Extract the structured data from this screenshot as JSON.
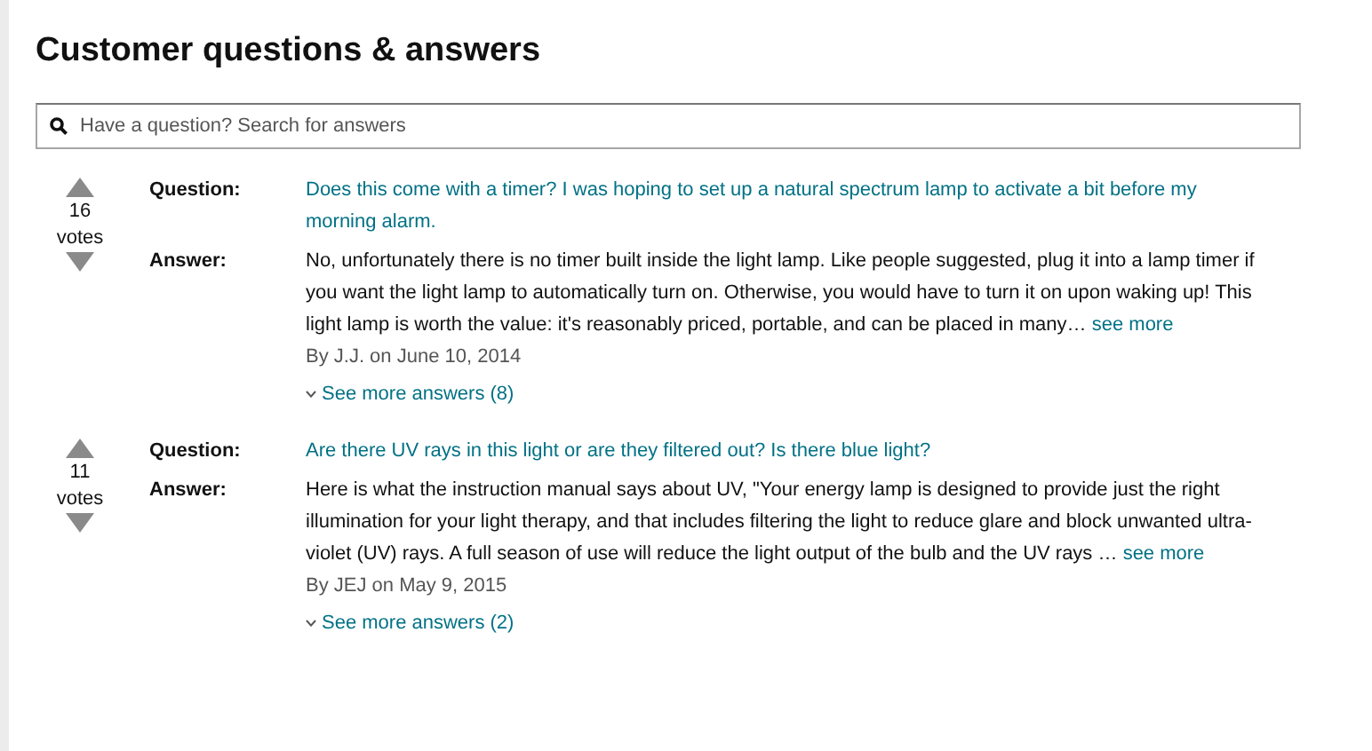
{
  "title": "Customer questions & answers",
  "search": {
    "placeholder": "Have a question? Search for answers"
  },
  "questions": [
    {
      "votes": "16",
      "votes_label": "votes",
      "question_label": "Question:",
      "question": "Does this come with a timer? I was hoping to set up a natural spectrum lamp to activate a bit before my morning alarm.",
      "answer_label": "Answer:",
      "answer": "No, unfortunately there is no timer built inside the light lamp. Like people suggested, plug it into a lamp timer if you want the light lamp to automatically turn on. Otherwise, you would have to turn it on upon waking up! This light lamp is worth the value: it's reasonably priced, portable, and can be placed in many…",
      "see_more": "see more",
      "byline": "By J.J. on June 10, 2014",
      "more_answers": "See more answers (8)"
    },
    {
      "votes": "11",
      "votes_label": "votes",
      "question_label": "Question:",
      "question": "Are there UV rays in this light or are they filtered out? Is there blue light?",
      "answer_label": "Answer:",
      "answer": "Here is what the instruction manual says about UV, \"Your energy lamp is designed to provide just the right illumination for your light therapy, and that includes filtering the light to reduce glare and block unwanted ultra-violet (UV) rays. A full season of use will reduce the light output of the bulb and the UV rays …",
      "see_more": "see more",
      "byline": "By JEJ on May 9, 2015",
      "more_answers": "See more answers (2)"
    }
  ]
}
